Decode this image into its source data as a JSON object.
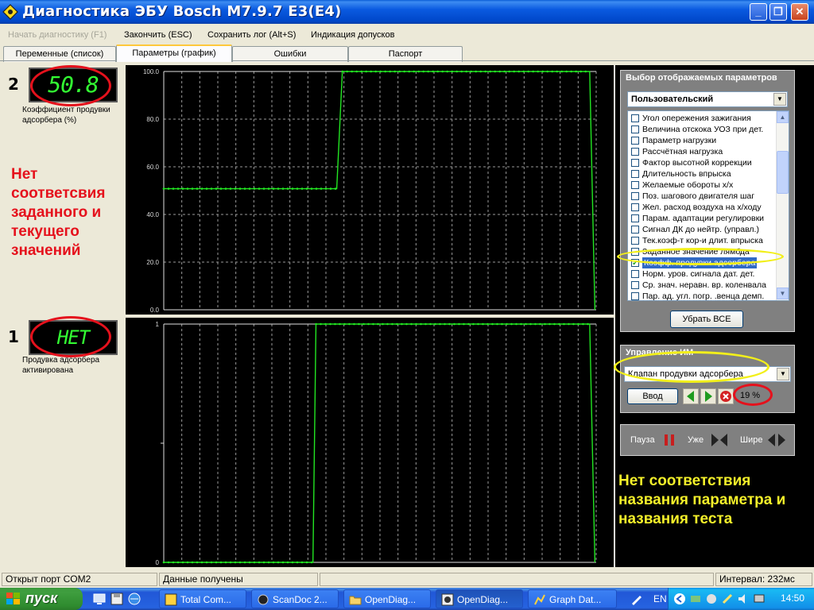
{
  "window": {
    "title": "Диагностика ЭБУ Bosch M7.9.7 E3(E4)",
    "controls": [
      "_",
      "❐",
      "✕"
    ]
  },
  "menu": {
    "start_diag": "Начать диагностику (F1)",
    "finish": "Закончить (ESC)",
    "save_log": "Сохранить лог (Alt+S)",
    "tolerances": "Индикация допусков"
  },
  "tabs": [
    "Переменные (список)",
    "Параметры (график)",
    "Ошибки",
    "Паспорт"
  ],
  "graph_panels": [
    {
      "number": "2",
      "lcd_value": "50.8",
      "label": "Коэффициент продувки адсорбера (%)",
      "y_ticks": [
        "100.0",
        "80.0",
        "60.0",
        "40.0",
        "20.0",
        "0.0"
      ]
    },
    {
      "number": "1",
      "lcd_value": "НЕТ",
      "label": "Продувка адсорбера активирована",
      "y_ticks": [
        "1",
        "0"
      ]
    }
  ],
  "chart_data": [
    {
      "type": "line",
      "ylim": [
        0,
        100
      ],
      "y_ticks": [
        100,
        80,
        60,
        40,
        20,
        0
      ],
      "series": [
        {
          "points_t": [
            0,
            0.4,
            0.413,
            0.985,
            0.997
          ],
          "values": [
            50.8,
            50.8,
            100,
            100,
            0
          ]
        }
      ]
    },
    {
      "type": "line",
      "ylim": [
        0,
        1
      ],
      "y_ticks": [
        1,
        0
      ],
      "series": [
        {
          "points_t": [
            0,
            0.345,
            0.352,
            0.985,
            0.997
          ],
          "values": [
            0,
            0,
            1,
            1,
            0
          ]
        }
      ]
    }
  ],
  "annotations": {
    "red_note": "Нет соответсвия заданного и текущего значений",
    "yellow_note": "Нет соответствия названия параметра и названия теста"
  },
  "param_select": {
    "title": "Выбор отображаемых параметров",
    "preset": "Пользовательский",
    "items": [
      {
        "label": "Угол опережения зажигания",
        "checked": false
      },
      {
        "label": "Величина отскока УОЗ при дет.",
        "checked": false
      },
      {
        "label": "Параметр нагрузки",
        "checked": false
      },
      {
        "label": "Рассчётная нагрузка",
        "checked": false
      },
      {
        "label": "Фактор высотной коррекции",
        "checked": false
      },
      {
        "label": "Длительность впрыска",
        "checked": false
      },
      {
        "label": "Желаемые обороты х/х",
        "checked": false
      },
      {
        "label": "Поз. шагового двигателя шаг",
        "checked": false
      },
      {
        "label": "Жел. расход воздуха на х/ходу",
        "checked": false
      },
      {
        "label": "Парам. адаптации регулировки",
        "checked": false
      },
      {
        "label": "Сигнал ДК до нейтр. (управл.)",
        "checked": false
      },
      {
        "label": "Тек.коэф-т кор-и длит. впрыска",
        "checked": false
      },
      {
        "label": "Заданное значение лямбда",
        "checked": false
      },
      {
        "label": "Коэфф. продувки адсорбера",
        "checked": true,
        "selected": true
      },
      {
        "label": "Норм. уров. сигнала дат. дет.",
        "checked": false
      },
      {
        "label": "Ср. знач. неравн. вр. коленвала",
        "checked": false
      },
      {
        "label": "Пар. ад. угл. погр. .венца демп.",
        "checked": false
      }
    ],
    "clear_all": "Убрать ВСЕ"
  },
  "im_control": {
    "title": "Управление ИМ",
    "selected": "Клапан продувки адсорбера",
    "enter": "Ввод",
    "percent": "19 %"
  },
  "playback": {
    "pause": "Пауза",
    "narrower": "Уже",
    "wider": "Шире"
  },
  "statusbar": {
    "port": "Открыт порт COM2",
    "data": "Данные получены",
    "interval": "Интервал: 232мс"
  },
  "taskbar": {
    "start": "пуск",
    "windows": [
      "Total Com...",
      "ScanDoc 2...",
      "OpenDiag...",
      "OpenDiag...",
      "Graph Dat..."
    ],
    "lang": "EN",
    "clock": "14:50"
  },
  "colors": {
    "trace": "#22e622",
    "annotation_red": "#e5111c",
    "annotation_yellow": "#f2ef1a"
  }
}
